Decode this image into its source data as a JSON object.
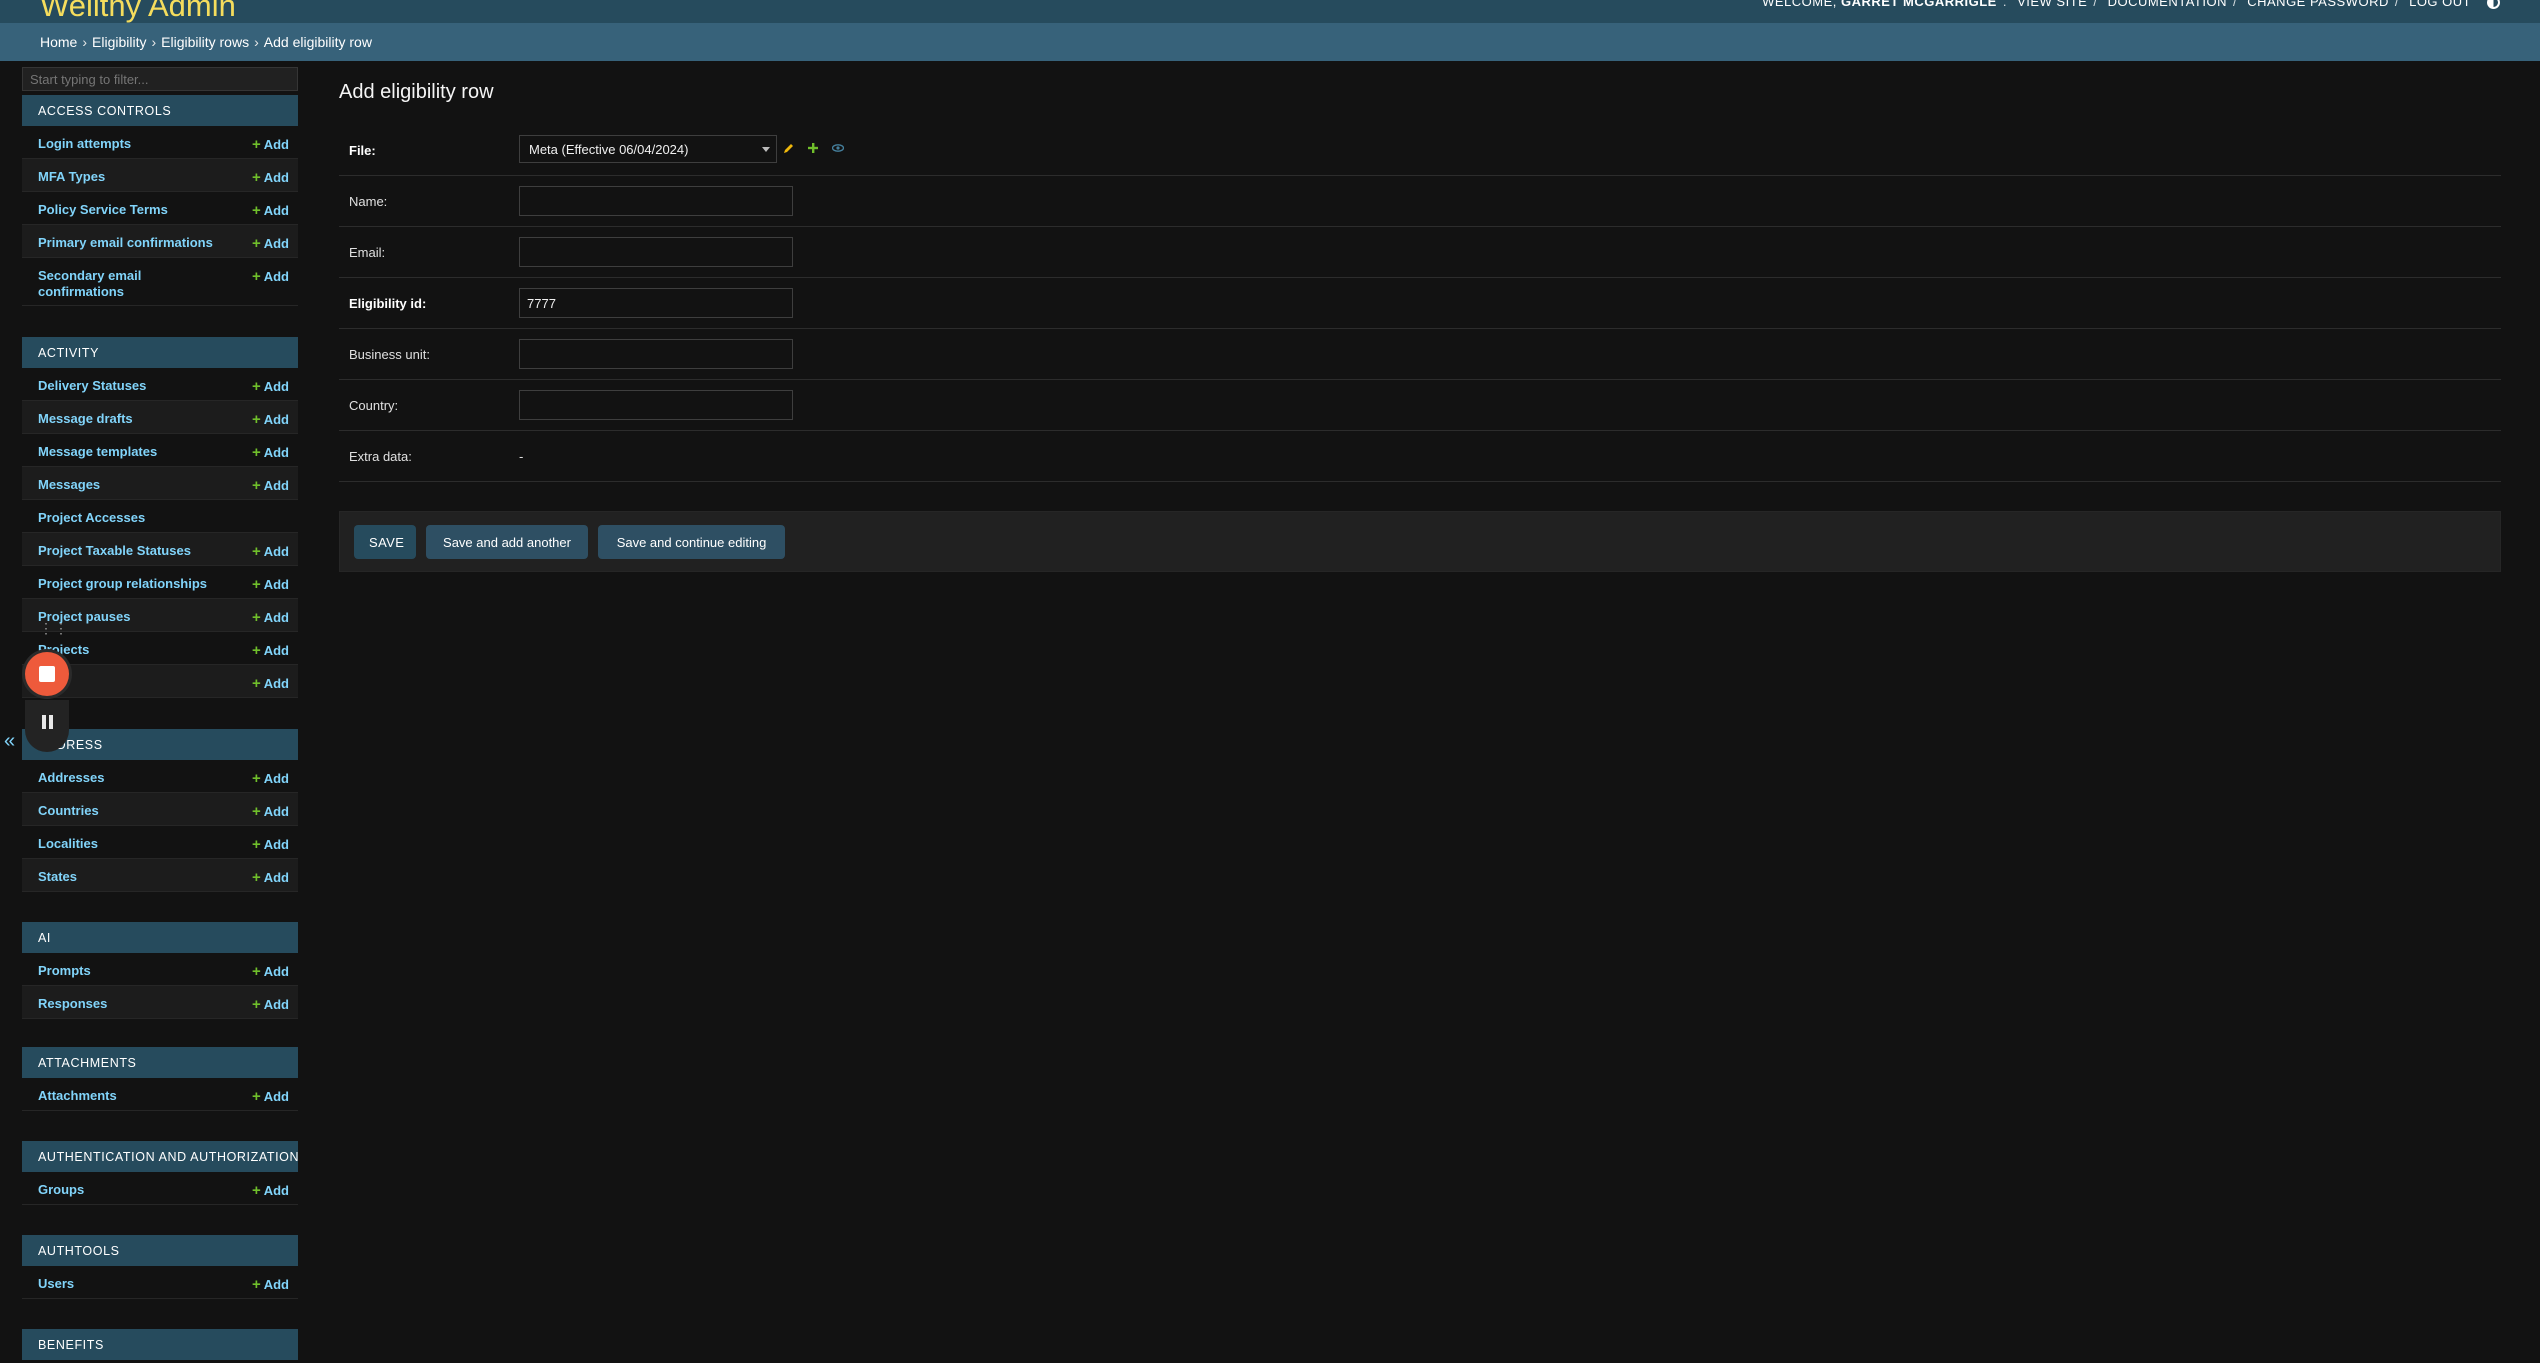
{
  "header": {
    "site_name": "Wellthy Admin",
    "welcome_prefix": "WELCOME,",
    "username": "GARRET MCGARRIGLE",
    "links": [
      "VIEW SITE",
      "DOCUMENTATION",
      "CHANGE PASSWORD",
      "LOG OUT"
    ]
  },
  "breadcrumbs": [
    "Home",
    "Eligibility",
    "Eligibility rows",
    "Add eligibility row"
  ],
  "sidebar": {
    "filter_placeholder": "Start typing to filter...",
    "add_label": "Add",
    "modules": [
      {
        "caption": "ACCESS CONTROLS",
        "items": [
          {
            "label": "Login attempts",
            "add": true
          },
          {
            "label": "MFA Types",
            "add": true
          },
          {
            "label": "Policy Service Terms",
            "add": true
          },
          {
            "label": "Primary email confirmations",
            "add": true
          },
          {
            "label": "Secondary email confirmations",
            "add": true
          }
        ]
      },
      {
        "caption": "ACTIVITY",
        "items": [
          {
            "label": "Delivery Statuses",
            "add": true
          },
          {
            "label": "Message drafts",
            "add": true
          },
          {
            "label": "Message templates",
            "add": true
          },
          {
            "label": "Messages",
            "add": true
          },
          {
            "label": "Project Accesses",
            "add": false
          },
          {
            "label": "Project Taxable Statuses",
            "add": true
          },
          {
            "label": "Project group relationships",
            "add": true
          },
          {
            "label": "Project pauses",
            "add": true
          },
          {
            "label": "Projects",
            "add": true
          },
          {
            "label": "",
            "add": true
          }
        ]
      },
      {
        "caption": "ADDRESS",
        "items": [
          {
            "label": "Addresses",
            "add": true
          },
          {
            "label": "Countries",
            "add": true
          },
          {
            "label": "Localities",
            "add": true
          },
          {
            "label": "States",
            "add": true
          }
        ]
      },
      {
        "caption": "AI",
        "items": [
          {
            "label": "Prompts",
            "add": true
          },
          {
            "label": "Responses",
            "add": true
          }
        ]
      },
      {
        "caption": "ATTACHMENTS",
        "items": [
          {
            "label": "Attachments",
            "add": true
          }
        ]
      },
      {
        "caption": "AUTHENTICATION AND AUTHORIZATION",
        "items": [
          {
            "label": "Groups",
            "add": true
          }
        ]
      },
      {
        "caption": "AUTHTOOLS",
        "items": [
          {
            "label": "Users",
            "add": true
          }
        ]
      },
      {
        "caption": "BENEFITS",
        "items": []
      }
    ]
  },
  "form": {
    "title": "Add eligibility row",
    "fields": {
      "file": {
        "label": "File:",
        "value": "Meta (Effective 06/04/2024)"
      },
      "name": {
        "label": "Name:",
        "value": ""
      },
      "email": {
        "label": "Email:",
        "value": ""
      },
      "eligibility_id": {
        "label": "Eligibility id:",
        "value": "7777"
      },
      "business_unit": {
        "label": "Business unit:",
        "value": ""
      },
      "country": {
        "label": "Country:",
        "value": ""
      },
      "extra_data": {
        "label": "Extra data:",
        "value": "-"
      }
    },
    "buttons": {
      "save": "SAVE",
      "save_add_another": "Save and add another",
      "save_continue": "Save and continue editing"
    }
  },
  "colors": {
    "header_bg": "#264b5d",
    "brand_yellow": "#f5dd5d",
    "link_blue": "#81d4fa",
    "add_green": "#70bf2b",
    "record_red": "#ee5a3b"
  }
}
